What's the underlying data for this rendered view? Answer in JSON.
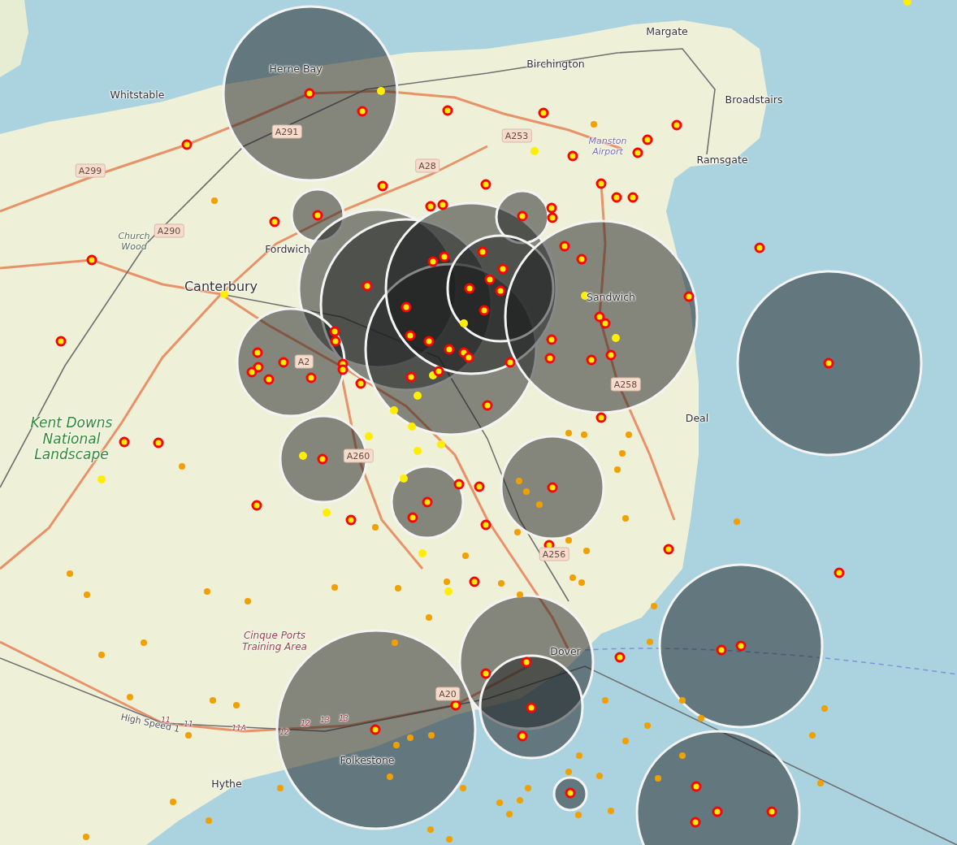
{
  "map": {
    "place_labels": [
      {
        "text": "Margate"
      },
      {
        "text": "Birchington"
      },
      {
        "text": "Herne Bay"
      },
      {
        "text": "Whitstable"
      },
      {
        "text": "Broadstairs"
      },
      {
        "text": "Ramsgate"
      },
      {
        "text": "Fordwich"
      },
      {
        "text": "Canterbury"
      },
      {
        "text": "Sandwich"
      },
      {
        "text": "Deal"
      },
      {
        "text": "Dover"
      },
      {
        "text": "Folkestone"
      },
      {
        "text": "Hythe"
      }
    ],
    "road_labels": [
      {
        "text": "A299"
      },
      {
        "text": "A291"
      },
      {
        "text": "A28"
      },
      {
        "text": "A253"
      },
      {
        "text": "A290"
      },
      {
        "text": "A2"
      },
      {
        "text": "A258"
      },
      {
        "text": "A260"
      },
      {
        "text": "A256"
      },
      {
        "text": "A20"
      }
    ],
    "area_labels": [
      {
        "text": "Manston Airport",
        "kind": "airport"
      },
      {
        "text": "Church Wood",
        "kind": "wood"
      },
      {
        "text": "Kent Downs National Landscape",
        "kind": "park"
      },
      {
        "text": "Cinque Ports Training Area",
        "kind": "military"
      }
    ],
    "junction_labels": [
      "11",
      "11",
      "11A",
      "12",
      "12",
      "13",
      "13"
    ],
    "route_label": "High Speed 1"
  }
}
